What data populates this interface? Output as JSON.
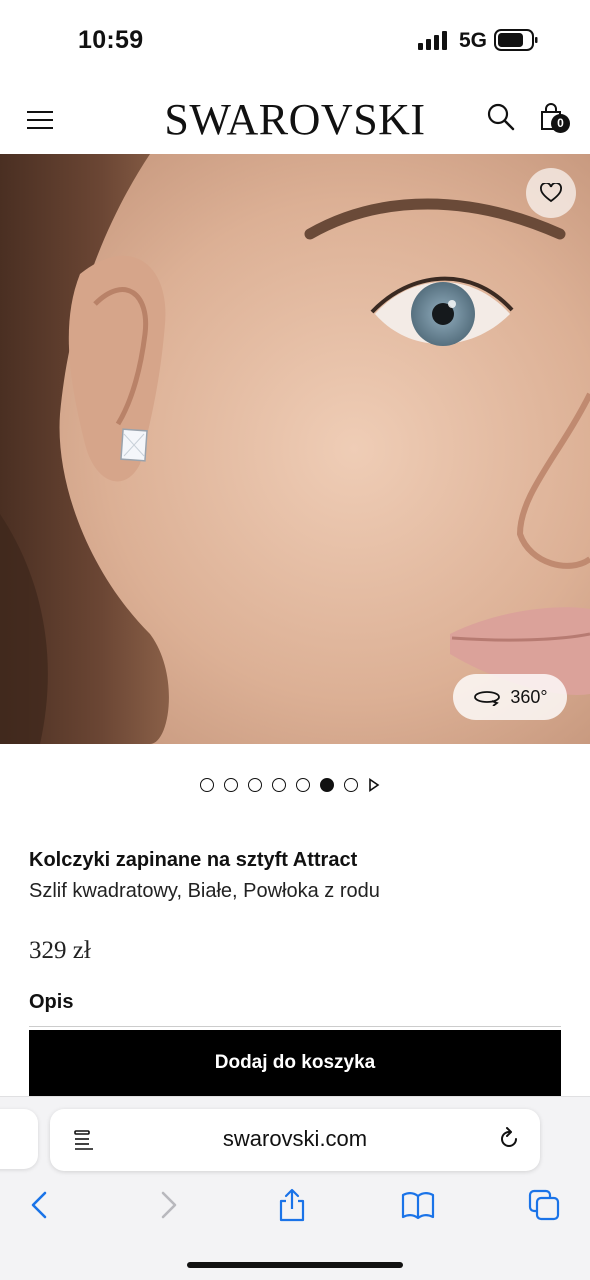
{
  "status_bar": {
    "time": "10:59",
    "network": "5G"
  },
  "header": {
    "logo": "SWAROVSKI",
    "bag_count": "0"
  },
  "gallery": {
    "view360_label": "360°",
    "dots_count": 7,
    "active_dot": 6
  },
  "product": {
    "title": "Kolczyki zapinane na sztyft Attract",
    "subtitle": "Szlif kwadratowy, Białe, Powłoka z rodu",
    "price": "329 zł",
    "description_heading": "Opis",
    "add_to_cart_label": "Dodaj do koszyka"
  },
  "browser": {
    "url": "swarovski.com"
  },
  "colors": {
    "button_bg": "#000000",
    "skin_tone": "#d9ad91",
    "browser_blue": "#1a73e8"
  }
}
